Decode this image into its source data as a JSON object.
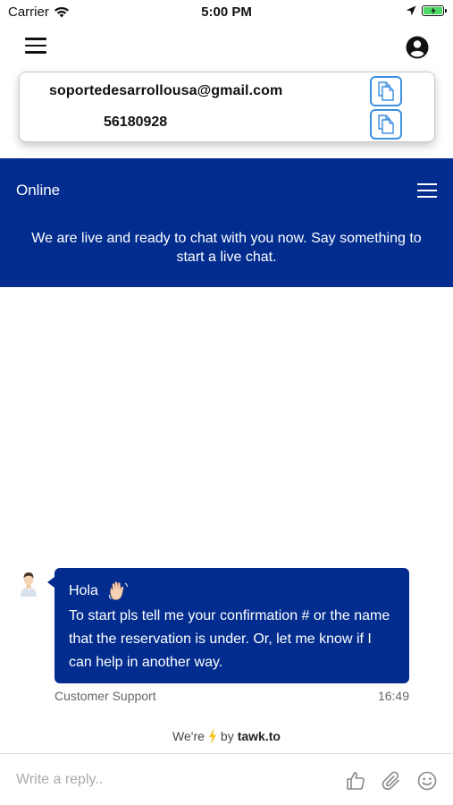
{
  "status_bar": {
    "carrier": "Carrier",
    "time": "5:00 PM"
  },
  "contact_card": {
    "email": "soportedesarrollousa@gmail.com",
    "phone": "56180928"
  },
  "chat": {
    "status": "Online",
    "intro": "We are live and ready to chat with you now. Say something to start a live chat.",
    "message": {
      "greeting": "Hola",
      "body": "To start pls tell me your confirmation # or the name that the reservation is under. Or, let me know if I can help in another way.",
      "sender": "Customer Support",
      "time": "16:49"
    },
    "powered": {
      "prefix": "We're",
      "by": "by",
      "brand": "tawk.to"
    },
    "composer": {
      "placeholder": "Write a reply.."
    }
  },
  "colors": {
    "brand": "#022d8f",
    "copy_accent": "#3e8fe0",
    "battery": "#4cd964"
  },
  "icons": [
    "wifi-icon",
    "location-arrow-icon",
    "battery-icon",
    "hamburger-icon",
    "account-icon",
    "copy-icon",
    "menu-icon",
    "avatar-icon",
    "wave-emoji-icon",
    "lightning-icon",
    "thumbs-up-icon",
    "paperclip-icon",
    "smiley-icon"
  ]
}
